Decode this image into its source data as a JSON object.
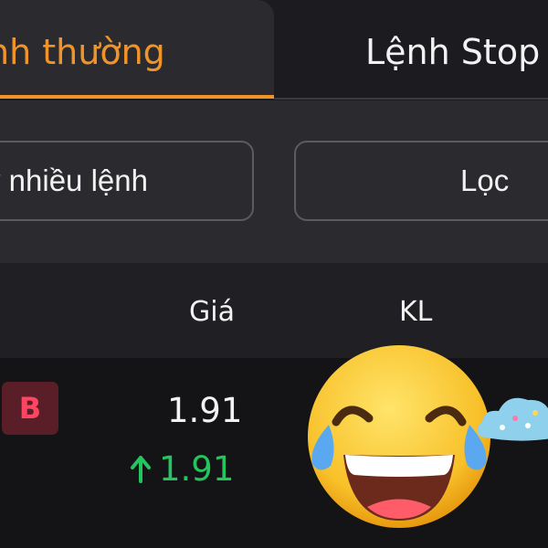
{
  "tabs": {
    "normal_label": "nh thường",
    "stop_label": "Lệnh Stop L"
  },
  "actions": {
    "cancel_label": "ỷ nhiều lệnh",
    "filter_label": "Lọc"
  },
  "table": {
    "columns": {
      "price": "Giá",
      "quantity": "KL"
    }
  },
  "order": {
    "side_badge": "B",
    "price": "1.91",
    "last_price": "1.91",
    "last_price_direction": "up"
  },
  "colors": {
    "accent": "#f0942a",
    "buy": "#ff4562",
    "up": "#22c55e"
  },
  "overlay": {
    "emoji": "face-with-tears-of-joy-icon",
    "sticker": "cloud-icon"
  }
}
